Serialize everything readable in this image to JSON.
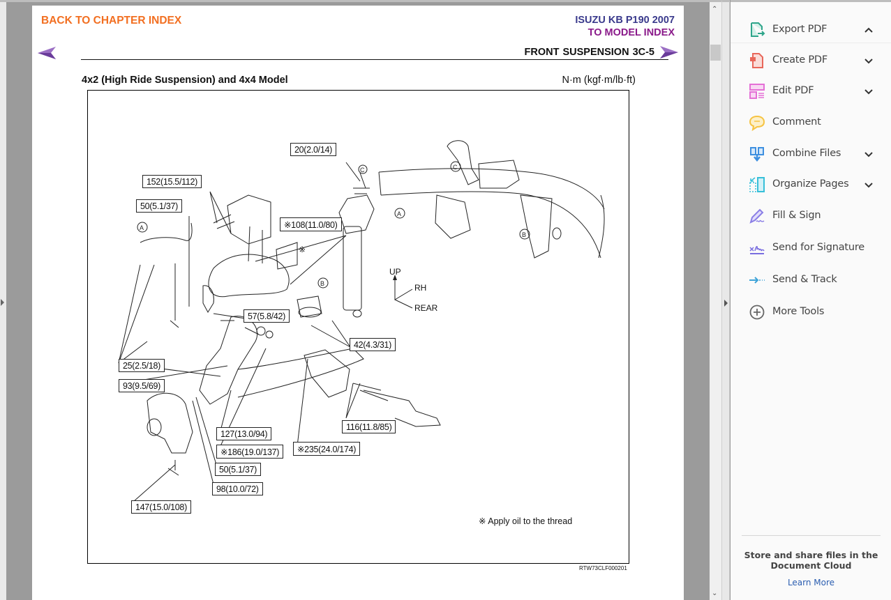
{
  "document": {
    "back_link": "BACK TO CHAPTER INDEX",
    "model_title": "ISUZU KB P190 2007",
    "model_index_link": "TO MODEL INDEX",
    "section_title": "FRONT SUSPENSION  3C-5",
    "subtitle": "4x2 (High Ride Suspension) and 4x4 Model",
    "units": "N·m (kgf·m/lb·ft)",
    "colors": {
      "back_link": "#f26f21",
      "model_title": "#3a3a8c",
      "model_index": "#8a1a8a",
      "nav_arrow": "#8e5bb5"
    },
    "diagram": {
      "torque_labels": [
        "20(2.0/14)",
        "152(15.5/112)",
        "50(5.1/37)",
        "※108(11.0/80)",
        "57(5.8/42)",
        "42(4.3/31)",
        "25(2.5/18)",
        "93(9.5/69)",
        "116(11.8/85)",
        "127(13.0/94)",
        "※186(19.0/137)",
        "※235(24.0/174)",
        "50(5.1/37)",
        "98(10.0/72)",
        "147(15.0/108)"
      ],
      "callouts": [
        "A",
        "B",
        "C",
        "A",
        "B",
        "C"
      ],
      "oil_mark": "※",
      "axes": {
        "up": "UP",
        "rh": "RH",
        "rear": "REAR"
      },
      "note": "※ Apply oil to the thread",
      "figure_id": "RTW73CLF000201"
    }
  },
  "tools_pane": {
    "items": [
      {
        "label": "Export PDF",
        "icon": "export-pdf-icon",
        "chevron": "up",
        "color": "#2ea58a"
      },
      {
        "label": "Create PDF",
        "icon": "create-pdf-icon",
        "chevron": "down",
        "color": "#e8675a"
      },
      {
        "label": "Edit PDF",
        "icon": "edit-pdf-icon",
        "chevron": "down",
        "color": "#e46fd6"
      },
      {
        "label": "Comment",
        "icon": "comment-icon",
        "chevron": null,
        "color": "#f6c342"
      },
      {
        "label": "Combine Files",
        "icon": "combine-files-icon",
        "chevron": "down",
        "color": "#3d8fe0"
      },
      {
        "label": "Organize Pages",
        "icon": "organize-pages-icon",
        "chevron": "down",
        "color": "#36bfd9"
      },
      {
        "label": "Fill & Sign",
        "icon": "fill-sign-icon",
        "chevron": null,
        "color": "#8a7ee6"
      },
      {
        "label": "Send for Signature",
        "icon": "send-signature-icon",
        "chevron": null,
        "color": "#7a6ee0"
      },
      {
        "label": "Send & Track",
        "icon": "send-track-icon",
        "chevron": null,
        "color": "#3ea3d8"
      },
      {
        "label": "More Tools",
        "icon": "more-tools-icon",
        "chevron": null,
        "color": "#666666"
      }
    ],
    "cloud_promo": "Store and share files in the Document Cloud",
    "learn_more": "Learn More"
  }
}
